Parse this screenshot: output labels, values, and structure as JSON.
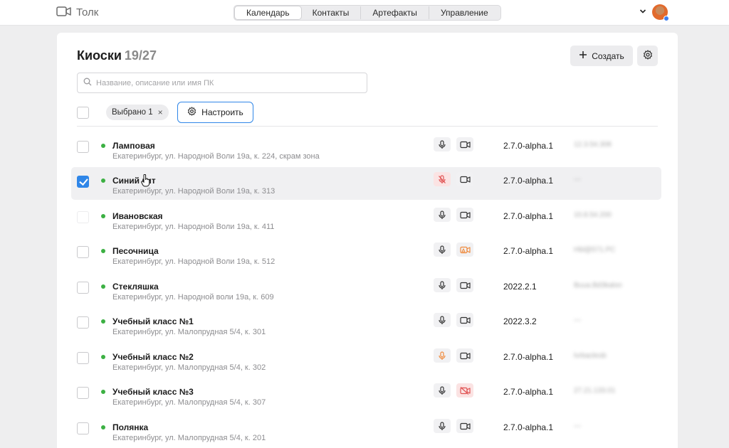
{
  "app": {
    "name": "Толк"
  },
  "nav": {
    "tabs": [
      {
        "label": "Календарь",
        "active": true
      },
      {
        "label": "Контакты",
        "active": false
      },
      {
        "label": "Артефакты",
        "active": false
      },
      {
        "label": "Управление",
        "active": false
      }
    ]
  },
  "header": {
    "title": "Киоски",
    "count": "19/27",
    "create_label": "Создать"
  },
  "search": {
    "placeholder": "Название, описание или имя ПК",
    "value": ""
  },
  "selection": {
    "chip_label": "Выбрано 1",
    "configure_label": "Настроить"
  },
  "colors": {
    "accent": "#2f86e8",
    "status_online": "#3cb043",
    "warning": "#f08a3c",
    "error": "#e05252"
  },
  "kiosks": [
    {
      "name": "Ламповая",
      "address": "Екатеринбург, ул. Народной Воли 19а, к. 224, скрам зона",
      "mic": "ok",
      "cam": "ok",
      "version": "2.7.0-alpha.1",
      "pc": "12.3.54.308",
      "checked": false
    },
    {
      "name": "Синий кит",
      "address": "Екатеринбург, ул. Народной Воли 19а, к. 313",
      "mic": "muted",
      "cam": "ok",
      "version": "2.7.0-alpha.1",
      "pc": "—",
      "checked": true
    },
    {
      "name": "Ивановская",
      "address": "Екатеринбург, ул. Народной Воли 19а, к. 411",
      "mic": "ok",
      "cam": "ok",
      "version": "2.7.0-alpha.1",
      "pc": "10.8.54.200",
      "checked": false
    },
    {
      "name": "Песочница",
      "address": "Екатеринбург, ул. Народной Воли 19а, к. 512",
      "mic": "ok",
      "cam": "warning",
      "version": "2.7.0-alpha.1",
      "pc": "Hbl@571.PC",
      "checked": false
    },
    {
      "name": "Стекляшка",
      "address": "Екатеринбург, ул. Народной воли 19а, к. 609",
      "mic": "ok",
      "cam": "ok",
      "version": "2022.2.1",
      "pc": "Buua.Bd3kalon",
      "checked": false
    },
    {
      "name": "Учебный класс №1",
      "address": "Екатеринбург, ул. Малопрудная 5/4, к. 301",
      "mic": "ok",
      "cam": "ok",
      "version": "2022.3.2",
      "pc": "—",
      "checked": false
    },
    {
      "name": "Учебный класс №2",
      "address": "Екатеринбург, ул. Малопрудная 5/4, к. 302",
      "mic": "warning",
      "cam": "ok",
      "version": "2.7.0-alpha.1",
      "pc": "lvrbacleob",
      "checked": false
    },
    {
      "name": "Учебный класс №3",
      "address": "Екатеринбург, ул. Малопрудная 5/4, к. 307",
      "mic": "ok",
      "cam": "off",
      "version": "2.7.0-alpha.1",
      "pc": "27.21.133.01",
      "checked": false
    },
    {
      "name": "Полянка",
      "address": "Екатеринбург, ул. Малопрудная 5/4, к. 201",
      "mic": "ok",
      "cam": "ok",
      "version": "2.7.0-alpha.1",
      "pc": "—",
      "checked": false
    }
  ]
}
